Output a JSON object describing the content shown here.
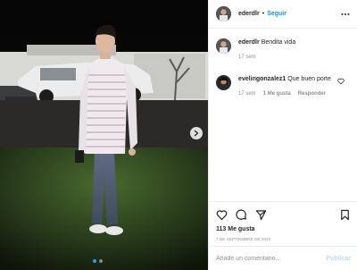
{
  "post": {
    "author": "ederdlr",
    "follow_separator": "•",
    "follow_label": "Seguir",
    "caption_author": "ederdlr",
    "caption_text": "Bendita vida",
    "caption_time": "17 sem",
    "comment": {
      "author": "evelingonzalez1",
      "text": "Que buen porte",
      "time": "17 sem",
      "likes": "1 Me gusta",
      "reply_label": "Responder"
    },
    "like_count": "113 Me gusta",
    "date": "7 DE SEPTIEMBRE DE 2020",
    "add_comment_placeholder": "Añade un comentario...",
    "publish_label": "Publicar",
    "carousel": {
      "slides": 2,
      "active": 0
    }
  },
  "icons": {
    "more": "more-options-icon",
    "heart": "heart-icon",
    "comment": "comment-icon",
    "share": "share-icon",
    "save": "bookmark-icon",
    "next": "chevron-right-icon"
  },
  "colors": {
    "link_blue": "#0095f6",
    "publish_disabled": "#b2dffc",
    "muted": "#8e8e8e"
  }
}
